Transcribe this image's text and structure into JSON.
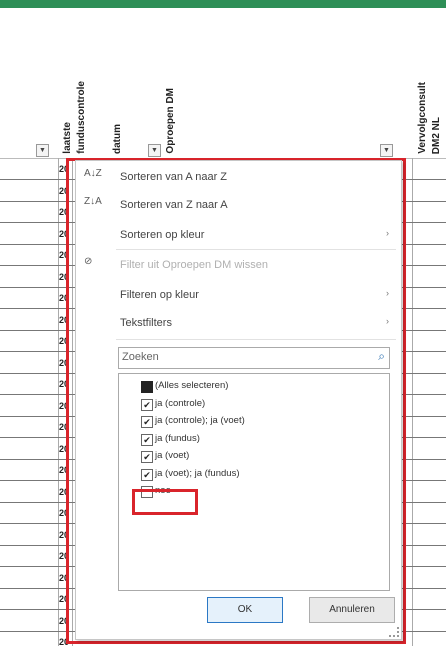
{
  "sheet": {
    "column_headers": [
      "laatste",
      "funduscontrole",
      "datum",
      "Oproepen DM",
      "Vervolgconsult",
      "DM2 NL"
    ],
    "row_value_stub": "20",
    "row_count": 23
  },
  "menu": {
    "items": [
      {
        "icon": "A↓Z",
        "label": "Sorteren van A naar Z",
        "submenu": false,
        "disabled": false
      },
      {
        "icon": "Z↓A",
        "label": "Sorteren van Z naar A",
        "submenu": false,
        "disabled": false
      },
      {
        "icon": "",
        "label": "Sorteren op kleur",
        "submenu": true,
        "disabled": false
      },
      {
        "icon": "⊘",
        "label": "Filter uit Oproepen DM wissen",
        "submenu": false,
        "disabled": true
      },
      {
        "icon": "",
        "label": "Filteren op kleur",
        "submenu": true,
        "disabled": false
      },
      {
        "icon": "",
        "label": "Tekstfilters",
        "submenu": true,
        "disabled": false
      }
    ],
    "submenu_arrow": "›",
    "search": {
      "placeholder": "Zoeken",
      "icon": "search-icon"
    },
    "filter_values": [
      {
        "label": "(Alles selecteren)",
        "state": "indeterminate"
      },
      {
        "label": "ja (controle)",
        "state": "checked"
      },
      {
        "label": "ja (controle); ja (voet)",
        "state": "checked"
      },
      {
        "label": "ja (fundus)",
        "state": "checked"
      },
      {
        "label": "ja (voet)",
        "state": "checked"
      },
      {
        "label": "ja (voet); ja (fundus)",
        "state": "checked"
      },
      {
        "label": "nee",
        "state": "unchecked"
      }
    ],
    "ok_label": "OK",
    "cancel_label": "Annuleren"
  },
  "colors": {
    "highlight": "#d9242b",
    "header_bar": "#2e8f57"
  }
}
